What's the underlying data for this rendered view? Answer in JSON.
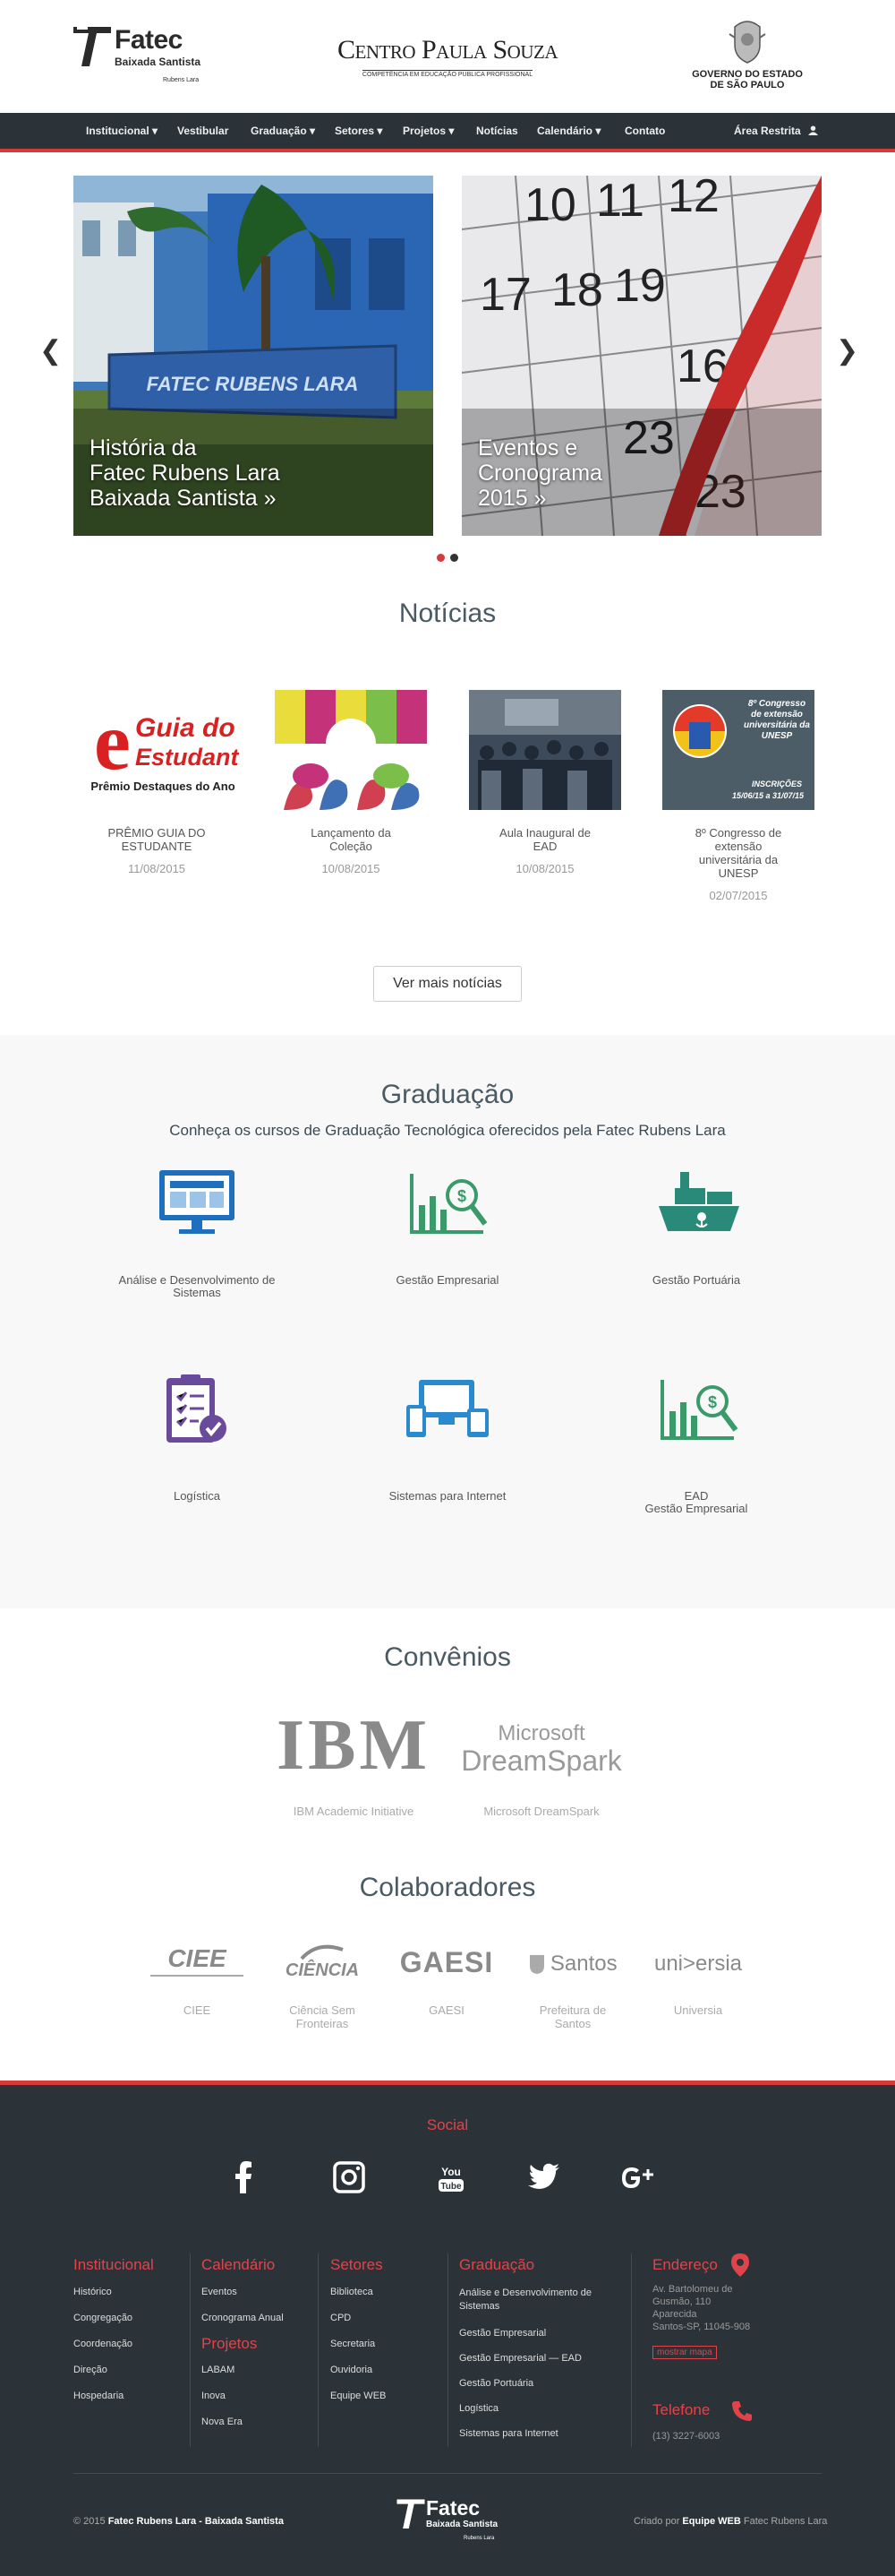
{
  "header": {
    "fatec_name": "Fatec",
    "fatec_sub": "Baixada Santista",
    "fatec_sub2": "Rubens Lara",
    "cps_name": "Centro Paula Souza",
    "cps_sub": "COMPETÊNCIA EM EDUCAÇÃO PÚBLICA PROFISSIONAL",
    "gov_line1": "GOVERNO DO ESTADO",
    "gov_line2": "DE SÃO PAULO"
  },
  "nav": {
    "items": [
      {
        "label": "Institucional ▾"
      },
      {
        "label": "Vestibular"
      },
      {
        "label": "Graduação ▾"
      },
      {
        "label": "Setores ▾"
      },
      {
        "label": "Projetos ▾"
      },
      {
        "label": "Notícias"
      },
      {
        "label": "Calendário ▾"
      },
      {
        "label": "Contato"
      }
    ],
    "restricted": "Área Restrita"
  },
  "carousel": {
    "slide1_line1": "História da",
    "slide1_line2": "Fatec Rubens Lara",
    "slide1_line3": "Baixada Santista »",
    "slide1_sign": "FATEC RUBENS LARA",
    "slide2_line1": "Eventos e",
    "slide2_line2": "Cronograma",
    "slide2_line3": "2015 »",
    "prev": "❮",
    "next": "❯"
  },
  "news": {
    "title": "Notícias",
    "more": "Ver mais notícias",
    "items": [
      {
        "title_l1": "PRÊMIO GUIA DO",
        "title_l2": "ESTUDANTE",
        "date": "11/08/2015",
        "img_big": "Guia do",
        "img_big2": "Estudante",
        "img_sub": "Prêmio Destaques do Ano"
      },
      {
        "title_l1": "Lançamento da",
        "title_l2": "Coleção",
        "date": "10/08/2015"
      },
      {
        "title_l1": "Aula Inaugural de",
        "title_l2": "EAD",
        "date": "10/08/2015"
      },
      {
        "title_l1": "8º Congresso de",
        "title_l2": "extensão",
        "title_l3": "universitária da",
        "title_l4": "UNESP",
        "date": "02/07/2015",
        "img_l1": "8º Congresso",
        "img_l2": "de extensão",
        "img_l3": "universitária da",
        "img_l4": "UNESP",
        "img_l5": "INSCRIÇÕES",
        "img_l6": "15/06/15 a 31/07/15"
      }
    ]
  },
  "graduacao": {
    "title": "Graduação",
    "subtitle": "Conheça os cursos de Graduação Tecnológica oferecidos pela Fatec Rubens Lara",
    "courses": [
      {
        "l1": "Análise e Desenvolvimento de",
        "l2": "Sistemas"
      },
      {
        "l1": "Gestão Empresarial"
      },
      {
        "l1": "Gestão Portuária"
      },
      {
        "l1": "Logística"
      },
      {
        "l1": "Sistemas para Internet"
      },
      {
        "l1": "EAD",
        "l2": "Gestão Empresarial"
      }
    ]
  },
  "convenios": {
    "title": "Convênios",
    "items": [
      {
        "logo": "IBM",
        "label": "IBM Academic Initiative"
      },
      {
        "logo1": "Microsoft",
        "logo2": "DreamSpark",
        "label": "Microsoft DreamSpark"
      }
    ]
  },
  "colaboradores": {
    "title": "Colaboradores",
    "items": [
      {
        "logo": "CIEE",
        "label": "CIEE"
      },
      {
        "logo": "CIÊNCIA",
        "label_l1": "Ciência Sem",
        "label_l2": "Fronteiras"
      },
      {
        "logo": "GAESI",
        "label": "GAESI"
      },
      {
        "logo": "Santos",
        "label_l1": "Prefeitura de",
        "label_l2": "Santos"
      },
      {
        "logo": "uni>ersia",
        "label": "Universia"
      }
    ]
  },
  "footer": {
    "social_title": "Social",
    "social_icons": [
      "facebook-icon",
      "instagram-icon",
      "youtube-icon",
      "twitter-icon",
      "google-plus-icon"
    ],
    "institucional": {
      "title": "Institucional",
      "links": [
        "Histórico",
        "Congregação",
        "Coordenação",
        "Direção",
        "Hospedaria"
      ]
    },
    "calendario": {
      "title": "Calendário",
      "links": [
        "Eventos",
        "Cronograma Anual"
      ]
    },
    "projetos": {
      "title": "Projetos",
      "links": [
        "LABAM",
        "Inova",
        "Nova Era"
      ]
    },
    "setores": {
      "title": "Setores",
      "links": [
        "Biblioteca",
        "CPD",
        "Secretaria",
        "Ouvidoria",
        "Equipe WEB"
      ]
    },
    "graduacao": {
      "title": "Graduação",
      "links": [
        "Análise e Desenvolvimento de",
        "Sistemas",
        "Gestão Empresarial",
        "Gestão Empresarial — EAD",
        "Gestão Portuária",
        "Logística",
        "Sistemas para Internet"
      ]
    },
    "endereco": {
      "title": "Endereço",
      "l1": "Av. Bartolomeu de",
      "l2": "Gusmão, 110",
      "l3": "Aparecida",
      "l4": "Santos-SP, 11045-908",
      "map": "mostrar mapa"
    },
    "telefone": {
      "title": "Telefone",
      "number": "(13) 3227-6003"
    },
    "copyright_pre": "© 2015 ",
    "copyright_name": "Fatec Rubens Lara - Baixada Santista",
    "credit_pre": "Criado por ",
    "credit_team": "Equipe WEB",
    "credit_post": " Fatec Rubens Lara",
    "logo_name": "Fatec",
    "logo_sub": "Baixada Santista",
    "logo_sub2": "Rubens Lara"
  },
  "colors": {
    "accent": "#d83a3a",
    "dark": "#2b3338",
    "heading": "#4a5a63"
  }
}
